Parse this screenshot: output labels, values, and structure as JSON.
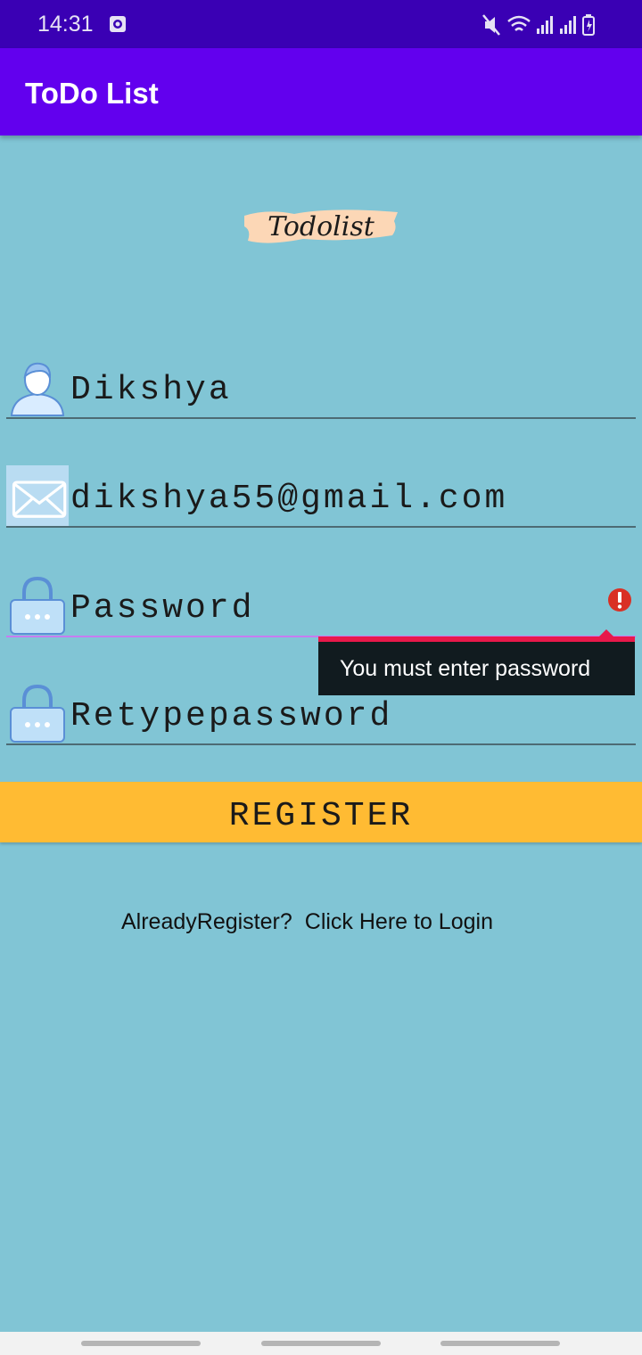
{
  "status_bar": {
    "time": "14:31",
    "icons": [
      "screen-record-icon",
      "mute-icon",
      "wifi-icon",
      "signal-icon",
      "signal-icon-2",
      "battery-icon"
    ]
  },
  "app_bar": {
    "title": "ToDo List"
  },
  "logo": {
    "text": "Todolist"
  },
  "form": {
    "username": {
      "value": "Dikshya",
      "icon": "user-icon"
    },
    "email": {
      "value": "dikshya55@gmail.com",
      "icon": "mail-icon"
    },
    "password": {
      "placeholder": "Password",
      "icon": "lock-icon",
      "error": "You must enter password"
    },
    "retype_password": {
      "placeholder": "Retypepassword",
      "icon": "lock-icon"
    }
  },
  "register_button": {
    "label": "REGISTER"
  },
  "login": {
    "prompt": "AlreadyRegister?",
    "link": "Click Here to Login"
  },
  "colors": {
    "background": "#81c5d5",
    "status_bar": "#3a00b4",
    "app_bar": "#6200ee",
    "button": "#ffbb33",
    "error": "#e8194a"
  }
}
